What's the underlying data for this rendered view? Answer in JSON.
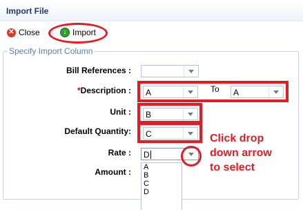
{
  "window": {
    "title": "Import File"
  },
  "toolbar": {
    "close_label": "Close",
    "import_label": "Import"
  },
  "group": {
    "legend": "Specify Import Column"
  },
  "fields": {
    "bill_references": {
      "label": "Bill References :",
      "value": ""
    },
    "description": {
      "required_mark": "*",
      "label": "Description :",
      "value": "A",
      "to_label": "To",
      "to_value": "A"
    },
    "unit": {
      "label": "Unit :",
      "value": "B"
    },
    "default_quantity": {
      "label": "Default Quantity:",
      "value": "C"
    },
    "rate": {
      "label": "Rate :",
      "value": "D"
    },
    "amount": {
      "label": "Amount :"
    }
  },
  "dropdown_options": [
    "A",
    "B",
    "C",
    "D"
  ],
  "annotation": {
    "line1": "Click drop",
    "line2": "down arrow",
    "line3": "to select"
  },
  "colors": {
    "highlight": "#e01c24",
    "title": "#1b3c63",
    "legend": "#5b7fa6"
  }
}
